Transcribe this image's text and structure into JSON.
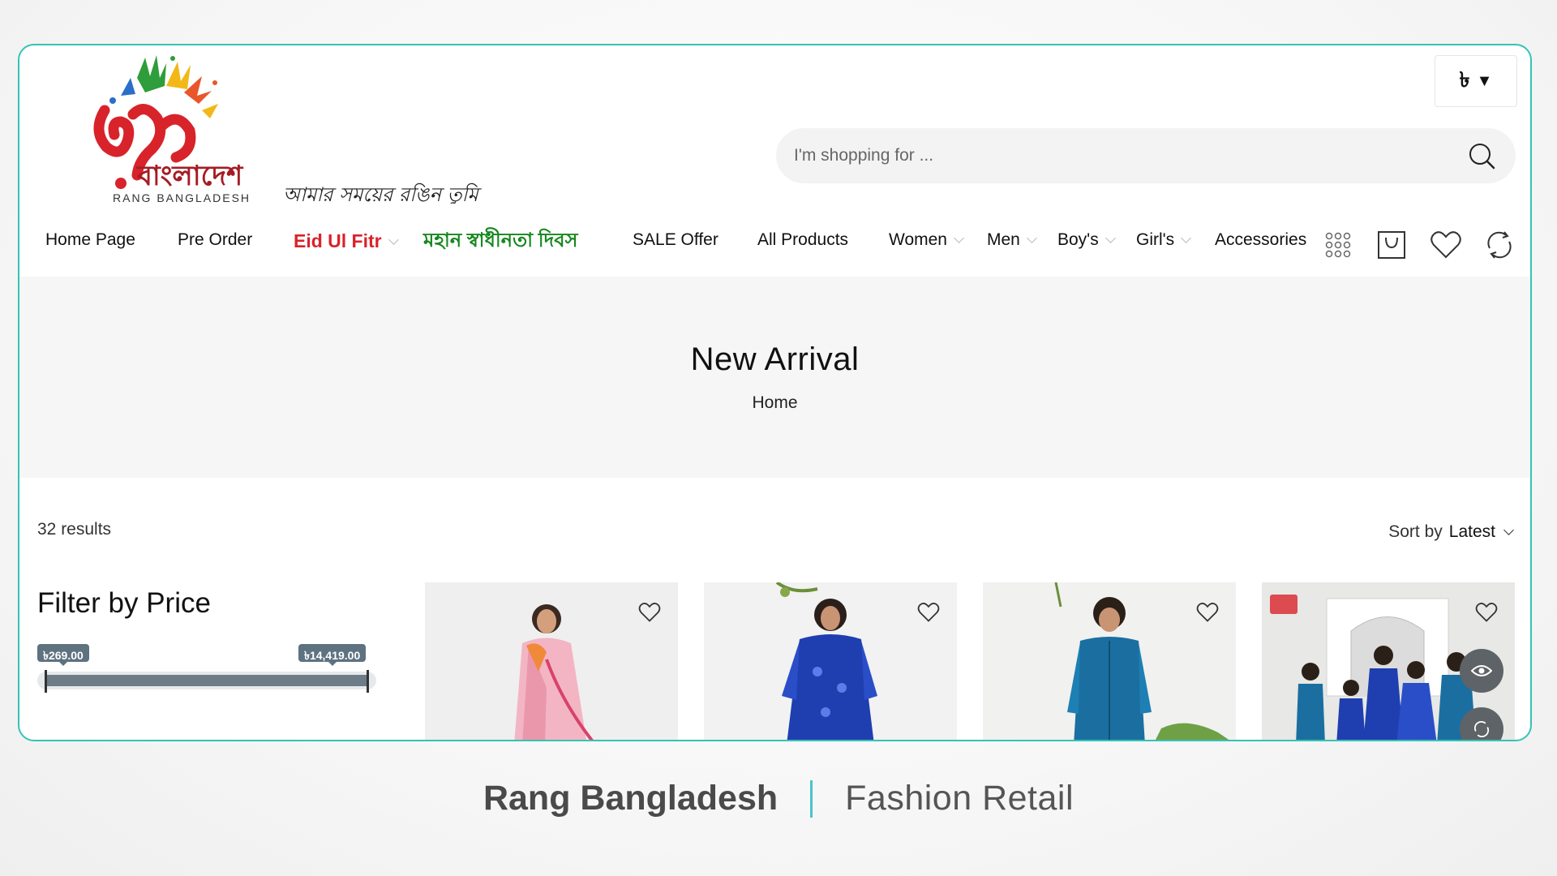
{
  "header": {
    "logo_text_bangla": "বাংলাদেশ",
    "logo_text_latin": "RANG BANGLADESH",
    "tagline": "আমার সময়ের রঙিন তুমি",
    "currency": "৳",
    "search_placeholder": "I'm shopping for ..."
  },
  "nav": {
    "items": [
      {
        "label": "Home Page"
      },
      {
        "label": "Pre Order"
      },
      {
        "label": "Eid Ul Fitr"
      },
      {
        "label": "মহান স্বাধীনতা দিবস"
      },
      {
        "label": "SALE Offer"
      },
      {
        "label": "All Products"
      },
      {
        "label": "Women"
      },
      {
        "label": "Men"
      },
      {
        "label": "Boy's"
      },
      {
        "label": "Girl's"
      },
      {
        "label": "Accessories"
      }
    ]
  },
  "banner": {
    "title": "New Arrival",
    "breadcrumb": "Home"
  },
  "listing": {
    "results": "32 results",
    "sort_prefix": "Sort by",
    "sort_value": "Latest"
  },
  "filter": {
    "title": "Filter by Price",
    "min_price": "৳269.00",
    "max_price": "৳14,419.00"
  },
  "caption": {
    "brand": "Rang Bangladesh",
    "tag": "Fashion Retail"
  },
  "colors": {
    "accent_border": "#35c3b6",
    "eid_red": "#d8232a",
    "bangla_green": "#17871f",
    "slider_fill": "#6c7d87"
  }
}
